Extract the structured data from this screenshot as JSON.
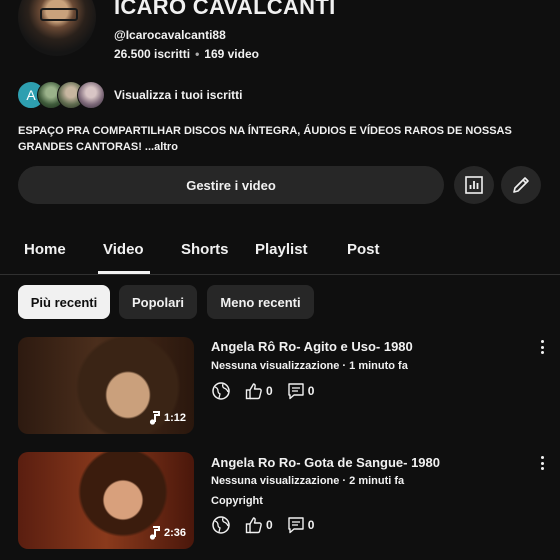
{
  "channel": {
    "name": "ICARO CAVALCANTI",
    "handle": "@Icarocavalcanti88",
    "subscribers": "26.500 iscritti",
    "videos": "169 video",
    "subscribers_avatar_letter": "A",
    "view_subscribers": "Visualizza i tuoi iscritti",
    "description": "ESPAÇO PRA COMPARTILHAR DISCOS NA ÍNTEGRA, ÁUDIOS E VÍDEOS RAROS DE NOSSAS GRANDES CANTORAS!",
    "more": "...altro"
  },
  "actions": {
    "manage_videos": "Gestire i video"
  },
  "tabs": [
    {
      "label": "Home"
    },
    {
      "label": "Video"
    },
    {
      "label": "Shorts"
    },
    {
      "label": "Playlist"
    },
    {
      "label": "Post"
    }
  ],
  "active_tab": "Video",
  "filters": [
    {
      "label": "Più recenti"
    },
    {
      "label": "Popolari"
    },
    {
      "label": "Meno recenti"
    }
  ],
  "selected_filter": "Più recenti",
  "videos": [
    {
      "title": "Angela Rô Ro- Agito e Uso- 1980",
      "meta": "Nessuna visualizzazione · 1 minuto fa",
      "duration": "1:12",
      "likes": "0",
      "comments": "0"
    },
    {
      "title": "Angela Ro Ro- Gota de Sangue- 1980",
      "meta": "Nessuna visualizzazione · 2 minuti fa",
      "extra": "Copyright",
      "duration": "2:36",
      "likes": "0",
      "comments": "0"
    }
  ],
  "colors": {
    "background": "#0f0f0f",
    "surface": "#272727",
    "text": "#f1f1f1",
    "selected_chip": "#f1f1f1"
  },
  "icons": {
    "stats": "bar-chart-icon",
    "edit": "pencil-icon",
    "visibility": "globe-icon",
    "like": "thumbs-up-icon",
    "comment": "comment-icon",
    "music": "music-note-icon",
    "more": "more-vert-icon"
  }
}
